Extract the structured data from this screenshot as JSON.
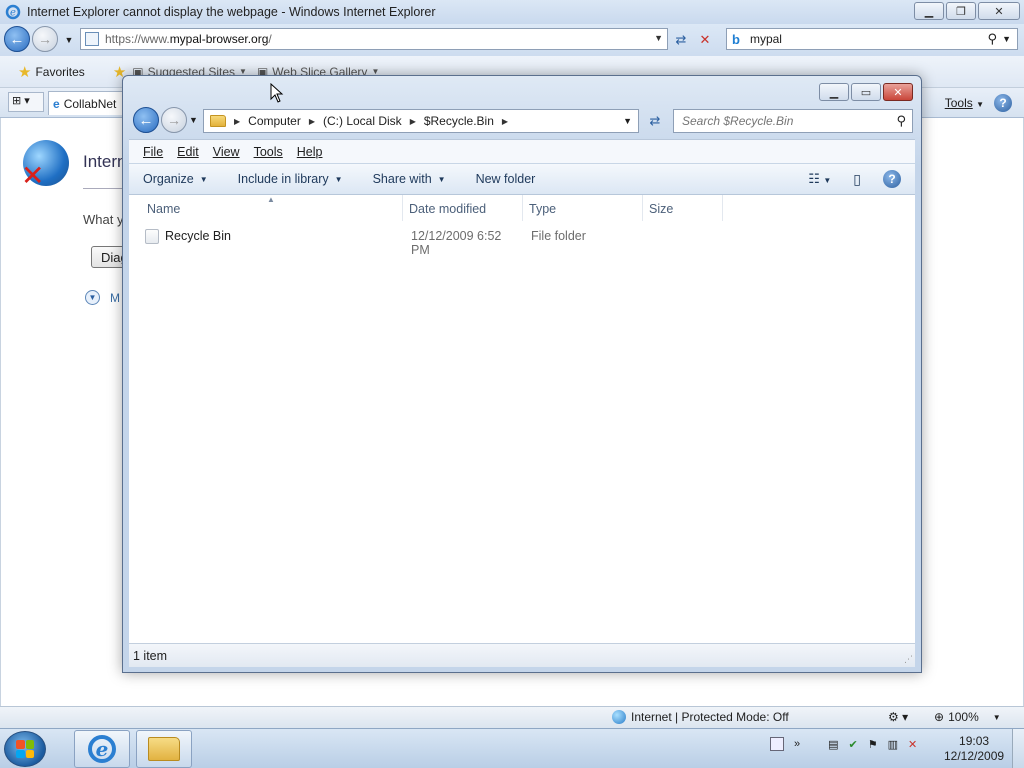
{
  "ie": {
    "title": "Internet Explorer cannot display the webpage - Windows Internet Explorer",
    "address_prefix": "https://www.",
    "address_domain": "mypal-browser.org",
    "address_suffix": "/",
    "search_value": "mypal",
    "favorites_label": "Favorites",
    "suggested_sites": "Suggested Sites",
    "web_slice_gallery": "Web Slice Gallery",
    "tab_label": "CollabNet",
    "tools_label": "Tools",
    "page": {
      "error_title": "Intern",
      "question": "What y",
      "diagnose_button": "Diag",
      "more_info": "M"
    },
    "status": {
      "zone": "Internet | Protected Mode: Off",
      "zoom": "100%"
    }
  },
  "explorer": {
    "breadcrumbs": [
      "Computer",
      "(C:) Local Disk",
      "$Recycle.Bin"
    ],
    "search_placeholder": "Search $Recycle.Bin",
    "menu": [
      "File",
      "Edit",
      "View",
      "Tools",
      "Help"
    ],
    "commands": [
      "Organize",
      "Include in library",
      "Share with",
      "New folder"
    ],
    "columns": [
      "Name",
      "Date modified",
      "Type",
      "Size"
    ],
    "rows": [
      {
        "name": "Recycle Bin",
        "date": "12/12/2009 6:52 PM",
        "type": "File folder",
        "size": ""
      }
    ],
    "status": "1 item"
  },
  "taskbar": {
    "time": "19:03",
    "date": "12/12/2009"
  },
  "icons": {
    "back": "back-arrow-icon",
    "forward": "forward-arrow-icon",
    "search": "search-icon",
    "help": "help-icon",
    "folder": "folder-icon"
  }
}
